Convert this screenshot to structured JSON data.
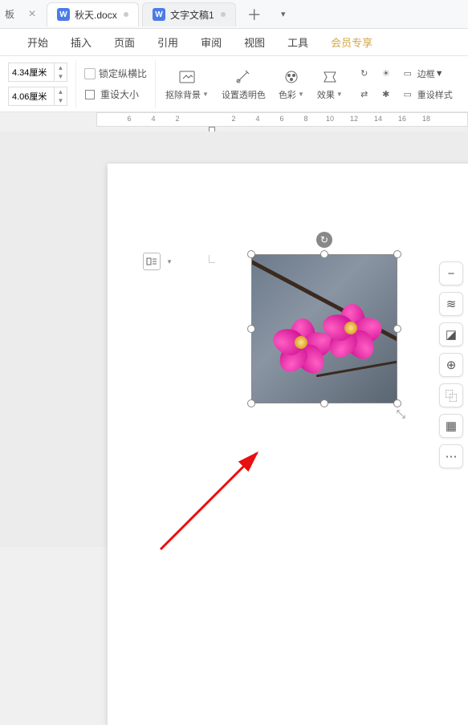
{
  "tabs": {
    "prefix": "板",
    "t1": "秋天.docx",
    "t2": "文字文稿1",
    "doc_glyph": "W"
  },
  "menu": {
    "m1": "开始",
    "m2": "插入",
    "m3": "页面",
    "m4": "引用",
    "m5": "审阅",
    "m6": "视图",
    "m7": "工具",
    "m8": "会员专享"
  },
  "ribbon": {
    "height": "4.34厘米",
    "width": "4.06厘米",
    "lock_ratio": "锁定纵横比",
    "reset_size": "重设大小",
    "remove_bg": "抠除背景",
    "set_transparent": "设置透明色",
    "color": "色彩",
    "effect": "效果",
    "border": "边框",
    "reset_style": "重设样式"
  },
  "ruler": {
    "r0": "6",
    "r1": "4",
    "r2": "2",
    "r3": "",
    "r4": "2",
    "r5": "4",
    "r6": "6",
    "r7": "8",
    "r8": "10",
    "r9": "12",
    "r10": "14",
    "r11": "16",
    "r12": "18"
  },
  "float_tools": {
    "minus": "−",
    "adjust": "≋",
    "crop": "◪",
    "zoom": "⊕",
    "copy": "⿻",
    "replace": "▦",
    "more": "⋯"
  }
}
